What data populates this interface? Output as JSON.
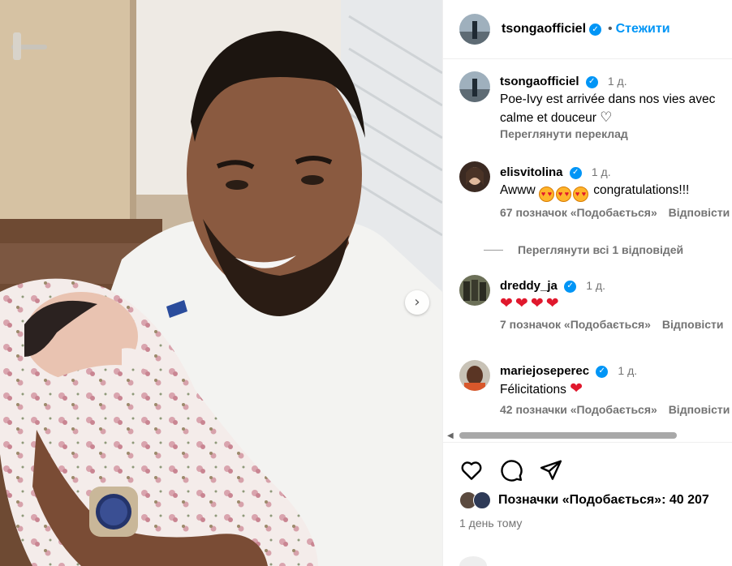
{
  "post": {
    "author": "tsongaofficiel",
    "follow_label": "Стежити",
    "caption": {
      "username": "tsongaofficiel",
      "time": "1 д.",
      "text_line1": "Poe-Ivy est arrivée dans nos vies avec",
      "text_line2": "calme et douceur",
      "translate_label": "Переглянути переклад"
    },
    "comments": [
      {
        "username": "elisvitolina",
        "time": "1 д.",
        "text": "Awww",
        "text_suffix": "congratulations!!!",
        "likes": "67 позначок «Подобається»",
        "reply": "Відповісти",
        "view_replies": "Переглянути всі 1 відповідей"
      },
      {
        "username": "dreddy_ja",
        "time": "1 д.",
        "hearts": [
          "❤",
          "❤",
          "❤",
          "❤"
        ],
        "likes": "7 позначок «Подобається»",
        "reply": "Відповісти"
      },
      {
        "username": "mariejoseperec",
        "time": "1 д.",
        "text": "Félicitations",
        "likes": "42 позначки «Подобається»",
        "reply": "Відповісти"
      }
    ],
    "likes_label": "Позначки «Подобається»: 40 207",
    "posted": "1 день тому"
  },
  "icons": {
    "verified": "✓",
    "next": "›",
    "scroll_left": "◀",
    "heart_outline": "♡",
    "red_heart": "❤"
  }
}
